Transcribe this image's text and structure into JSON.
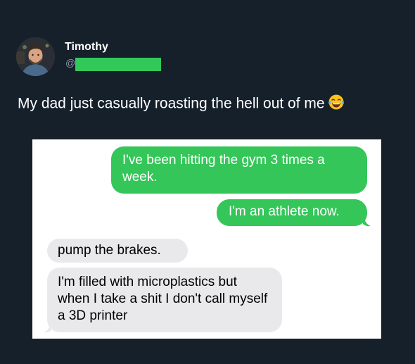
{
  "author": {
    "display_name": "Timothy",
    "handle_prefix": "@"
  },
  "tweet": {
    "text": "My dad just casually roasting the hell out of me",
    "emoji": "face-with-tears-of-joy-icon"
  },
  "conversation": {
    "messages": [
      {
        "direction": "sent",
        "text": "I've been hitting the gym 3 times a week."
      },
      {
        "direction": "sent",
        "text": "I'm an athlete now."
      },
      {
        "direction": "received",
        "text": "pump the brakes."
      },
      {
        "direction": "received",
        "text": "I'm filled with microplastics but when I take a shit I don't call myself a 3D printer"
      }
    ]
  },
  "colors": {
    "background": "#15202b",
    "sent_bubble": "#35c659",
    "received_bubble": "#e9e9eb",
    "redaction": "#33c85a"
  }
}
